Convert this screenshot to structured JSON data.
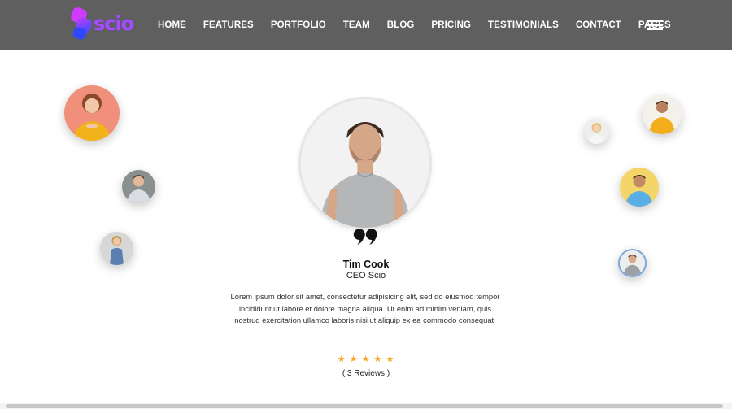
{
  "brand": {
    "logo_text": "scio"
  },
  "nav": {
    "items": [
      {
        "label": "HOME"
      },
      {
        "label": "FEATURES"
      },
      {
        "label": "PORTFOLIO"
      },
      {
        "label": "TEAM"
      },
      {
        "label": "BLOG"
      },
      {
        "label": "PRICING"
      },
      {
        "label": "TESTIMONIALS"
      },
      {
        "label": "CONTACT"
      },
      {
        "label": "PAGES"
      }
    ],
    "menu_icon": "hamburger-icon"
  },
  "testimonial": {
    "name": "Tim Cook",
    "role": "CEO Scio",
    "text": "Lorem ipsum dolor sit amet, consectetur adipisicing elit, sed do eiusmod tempor incididunt ut labore et dolore magna aliqua. Ut enim ad minim veniam, quis nostrud exercitation ullamco laboris nisi ut aliquip ex ea commodo consequat.",
    "rating": 5,
    "stars": [
      "★",
      "★",
      "★",
      "★",
      "★"
    ],
    "reviews_label": "( 3 Reviews )"
  },
  "colors": {
    "navbar": "#5f5f5f",
    "brand_purple": "#a54dff",
    "brand_blue": "#3a5cff",
    "star": "#f5a623"
  }
}
